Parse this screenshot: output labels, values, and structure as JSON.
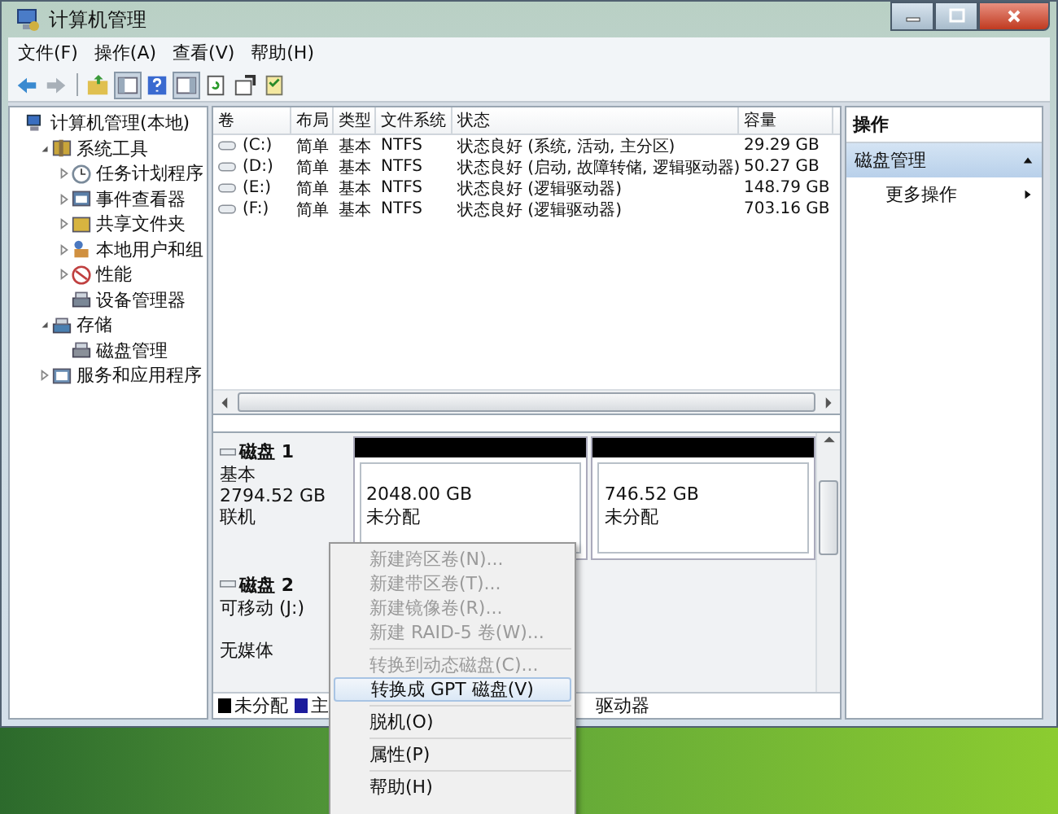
{
  "window": {
    "title": "计算机管理"
  },
  "menu": [
    "文件(F)",
    "操作(A)",
    "查看(V)",
    "帮助(H)"
  ],
  "tree": [
    {
      "label": "计算机管理(本地)",
      "children": [
        {
          "label": "系统工具",
          "expanded": true,
          "children": [
            {
              "label": "任务计划程序",
              "expanded": false
            },
            {
              "label": "事件查看器",
              "expanded": false
            },
            {
              "label": "共享文件夹",
              "expanded": false
            },
            {
              "label": "本地用户和组",
              "expanded": false
            },
            {
              "label": "性能",
              "expanded": false
            },
            {
              "label": "设备管理器"
            }
          ]
        },
        {
          "label": "存储",
          "expanded": true,
          "children": [
            {
              "label": "磁盘管理"
            }
          ]
        },
        {
          "label": "服务和应用程序",
          "expanded": false
        }
      ]
    }
  ],
  "table": {
    "columns": [
      "卷",
      "布局",
      "类型",
      "文件系统",
      "状态",
      "容量"
    ],
    "rows": [
      {
        "volume": "(C:)",
        "layout": "简单",
        "type": "基本",
        "fs": "NTFS",
        "status": "状态良好 (系统, 活动, 主分区)",
        "capacity": "29.29 GB"
      },
      {
        "volume": "(D:)",
        "layout": "简单",
        "type": "基本",
        "fs": "NTFS",
        "status": "状态良好 (启动, 故障转储, 逻辑驱动器)",
        "capacity": "50.27 GB"
      },
      {
        "volume": "(E:)",
        "layout": "简单",
        "type": "基本",
        "fs": "NTFS",
        "status": "状态良好 (逻辑驱动器)",
        "capacity": "148.79 GB"
      },
      {
        "volume": "(F:)",
        "layout": "简单",
        "type": "基本",
        "fs": "NTFS",
        "status": "状态良好 (逻辑驱动器)",
        "capacity": "703.16 GB"
      }
    ]
  },
  "disks": [
    {
      "name": "磁盘 1",
      "type": "基本",
      "size": "2794.52 GB",
      "status": "联机",
      "partitions": [
        {
          "size": "2048.00 GB",
          "status": "未分配"
        },
        {
          "size": "746.52 GB",
          "status": "未分配"
        }
      ]
    },
    {
      "name": "磁盘 2",
      "type": "可移动 (J:)",
      "status": "无媒体"
    }
  ],
  "legend": [
    {
      "label": "未分配",
      "color": "#000000"
    },
    {
      "label": "主",
      "color": "#1c1c9c"
    },
    {
      "label": "驱动器"
    }
  ],
  "actions": {
    "title": "操作",
    "sections": [
      {
        "label": "磁盘管理",
        "expanded": true,
        "items": [
          "更多操作"
        ]
      }
    ]
  },
  "context_menu": [
    {
      "kind": "item",
      "label": "新建跨区卷(N)...",
      "disabled": true,
      "selected": false
    },
    {
      "kind": "item",
      "label": "新建带区卷(T)...",
      "disabled": true,
      "selected": false
    },
    {
      "kind": "item",
      "label": "新建镜像卷(R)...",
      "disabled": true,
      "selected": false
    },
    {
      "kind": "item",
      "label": "新建 RAID-5 卷(W)...",
      "disabled": true,
      "selected": false
    },
    {
      "kind": "separator"
    },
    {
      "kind": "item",
      "label": "转换到动态磁盘(C)...",
      "disabled": true,
      "selected": false
    },
    {
      "kind": "item",
      "label": "转换成 GPT 磁盘(V)",
      "disabled": false,
      "selected": true
    },
    {
      "kind": "separator"
    },
    {
      "kind": "item",
      "label": "脱机(O)",
      "disabled": false,
      "selected": false
    },
    {
      "kind": "separator"
    },
    {
      "kind": "item",
      "label": "属性(P)",
      "disabled": false,
      "selected": false
    },
    {
      "kind": "separator"
    },
    {
      "kind": "item",
      "label": "帮助(H)",
      "disabled": false,
      "selected": false
    }
  ]
}
